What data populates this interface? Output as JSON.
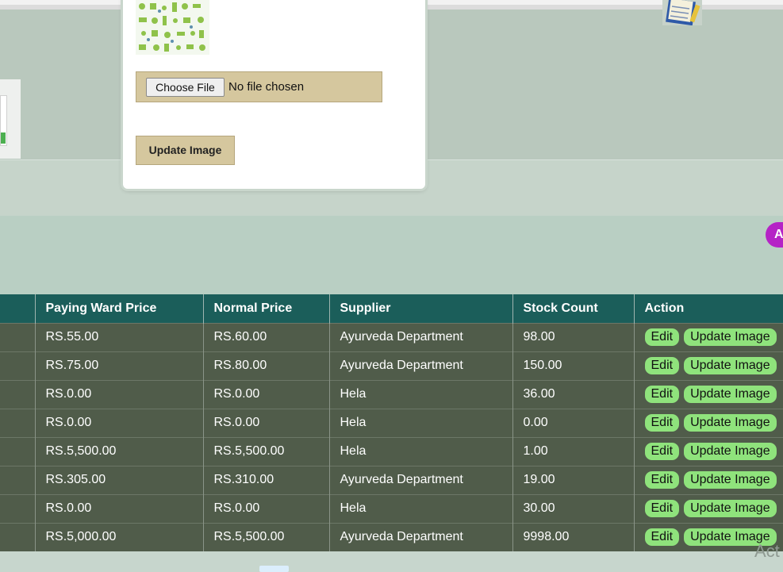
{
  "modal": {
    "file_button": "Choose File",
    "file_status": "No file chosen",
    "update_button": "Update Image"
  },
  "side_button": {
    "label": "A"
  },
  "table": {
    "headers": [
      "",
      "Paying Ward Price",
      "Normal Price",
      "Supplier",
      "Stock Count",
      "Action"
    ],
    "rows": [
      {
        "paying": "RS.55.00",
        "normal": "RS.60.00",
        "supplier": "Ayurveda Department",
        "stock": "98.00"
      },
      {
        "paying": "RS.75.00",
        "normal": "RS.80.00",
        "supplier": "Ayurveda Department",
        "stock": "150.00"
      },
      {
        "paying": "RS.0.00",
        "normal": "RS.0.00",
        "supplier": "Hela",
        "stock": "36.00"
      },
      {
        "paying": "RS.0.00",
        "normal": "RS.0.00",
        "supplier": "Hela",
        "stock": "0.00"
      },
      {
        "paying": "RS.5,500.00",
        "normal": "RS.5,500.00",
        "supplier": "Hela",
        "stock": "1.00"
      },
      {
        "paying": "RS.305.00",
        "normal": "RS.310.00",
        "supplier": "Ayurveda Department",
        "stock": "19.00"
      },
      {
        "paying": "RS.0.00",
        "normal": "RS.0.00",
        "supplier": "Hela",
        "stock": "30.00"
      },
      {
        "paying": "RS.5,000.00",
        "normal": "RS.5,500.00",
        "supplier": "Ayurveda Department",
        "stock": "9998.00"
      }
    ],
    "edit_label": "Edit",
    "update_label": "Update Image"
  },
  "watermark": "Act",
  "icons": {
    "notepad": "notepad-icon",
    "preview": "medical-pattern-thumbnail"
  },
  "colors": {
    "header_bg": "#1b5e5a",
    "row_bg": "#505c4a",
    "pill_bg": "#8fe37c",
    "modal_button_bg": "#d5c79e",
    "side_button_bg": "#b523c6"
  }
}
